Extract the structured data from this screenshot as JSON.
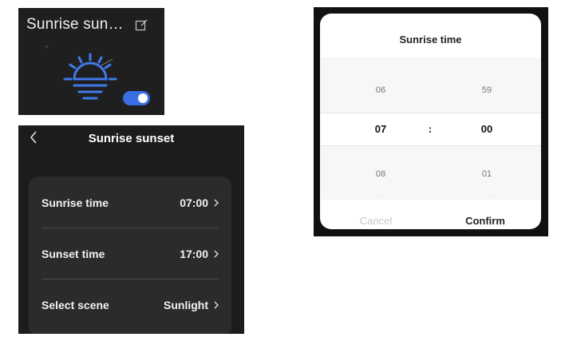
{
  "widget": {
    "title": "Sunrise sun…",
    "edit_icon": "edit-icon",
    "sun_icon": "sunrise-icon",
    "toggle_on": true,
    "accent_color": "#3a6fe3"
  },
  "settings": {
    "title": "Sunrise sunset",
    "back_icon": "chevron-left-icon",
    "rows": [
      {
        "label": "Sunrise time",
        "value": "07:00"
      },
      {
        "label": "Sunset time",
        "value": "17:00"
      },
      {
        "label": "Select scene",
        "value": "Sunlight"
      }
    ]
  },
  "picker": {
    "title": "Sunrise time",
    "hours": {
      "prev": "06",
      "selected": "07",
      "next": "08"
    },
    "minutes": {
      "prev": "59",
      "selected": "00",
      "next": "01"
    },
    "separator": ":",
    "cancel_label": "Cancel",
    "confirm_label": "Confirm"
  }
}
